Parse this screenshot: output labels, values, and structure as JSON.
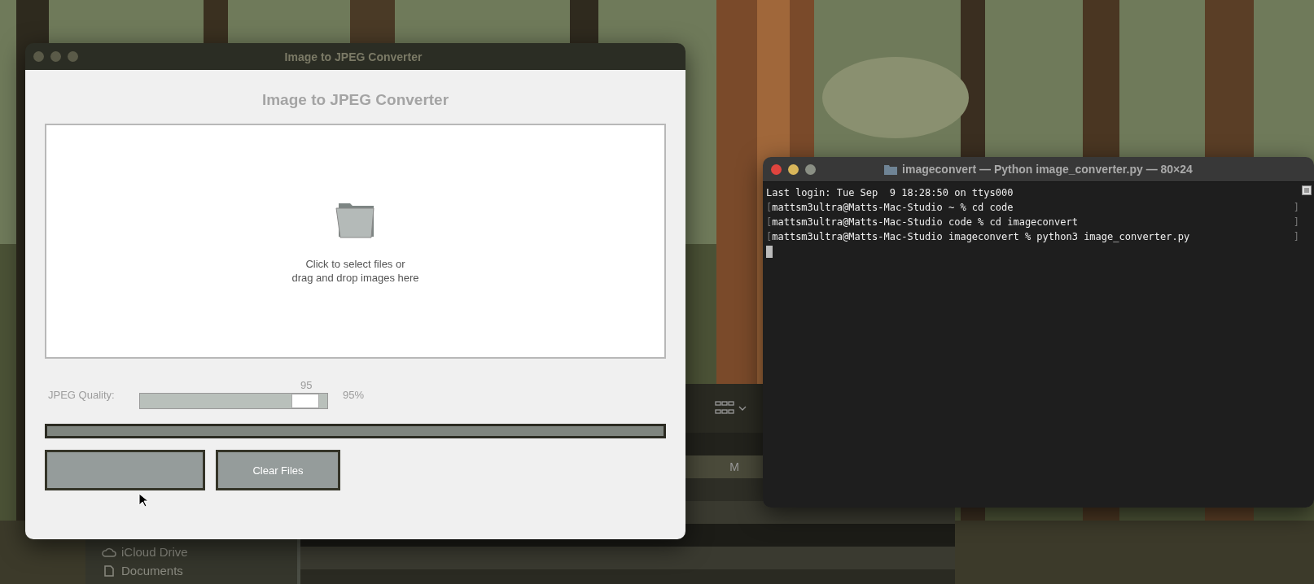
{
  "app_window": {
    "title": "Image to JPEG Converter",
    "heading": "Image to JPEG Converter",
    "drop_zone": {
      "lines": [
        "Click to select files or",
        "drag and drop images here"
      ]
    },
    "quality": {
      "label": "JPEG Quality:",
      "value": "95",
      "level": 0.95,
      "reading": "95%"
    },
    "progress": {
      "level": 0
    },
    "buttons": [
      {
        "kind": "convert"
      },
      {
        "kind": "clear",
        "label": "Clear Files"
      }
    ]
  },
  "terminal": {
    "title": "imageconvert — Python image_converter.py — 80×24",
    "lines": [
      {
        "kind": "plain",
        "text": "Last login: Tue Sep  9 18:28:50 on ttys000"
      },
      {
        "kind": "prompt",
        "text": "mattsm3ultra@Matts-Mac-Studio ~ % cd code",
        "open": "[",
        "close": "]"
      },
      {
        "kind": "prompt",
        "text": "mattsm3ultra@Matts-Mac-Studio code % cd imageconvert",
        "open": "[",
        "close": "]"
      },
      {
        "kind": "prompt",
        "text": "mattsm3ultra@Matts-Mac-Studio imageconvert % python3 image_converter.py",
        "open": "[",
        "close": "]"
      }
    ]
  },
  "finder": {
    "sidebar_items": [
      "iCloud Drive",
      "Documents"
    ],
    "row_text": "M"
  }
}
